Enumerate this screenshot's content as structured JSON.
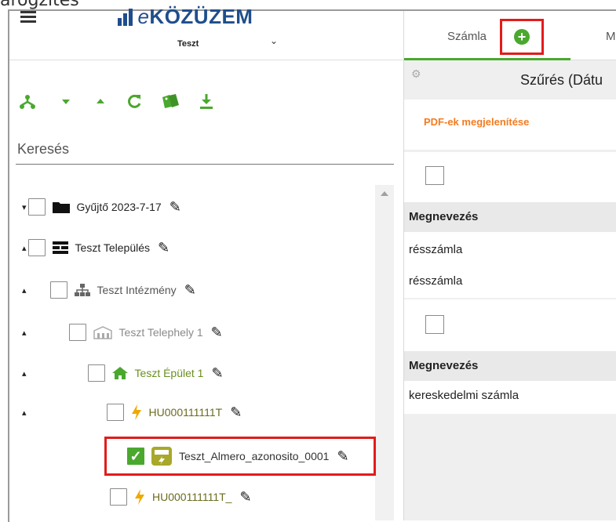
{
  "page_title_fragment": "árögzítés",
  "header": {
    "menu_icon": "hamburger-icon",
    "logo_prefix": "e",
    "logo_text": "KÖZÜZEM",
    "environment": "Teszt"
  },
  "toolbar": {
    "icons": [
      "hierarchy-icon",
      "caret-down-icon",
      "caret-up-icon",
      "refresh-icon",
      "tags-icon",
      "download-icon"
    ]
  },
  "search": {
    "label": "Keresés"
  },
  "tree": {
    "items": [
      {
        "label": "Gyűjtő 2023-7-17",
        "icon": "folder-icon",
        "caret": "down",
        "checked": false
      },
      {
        "label": "Teszt Település",
        "icon": "city-icon",
        "caret": "up",
        "checked": false
      },
      {
        "label": "Teszt Intézmény",
        "icon": "org-chart-icon",
        "caret": "up",
        "checked": false
      },
      {
        "label": "Teszt Telephely 1",
        "icon": "building-icon",
        "caret": "up",
        "checked": false
      },
      {
        "label": "Teszt Épület 1",
        "icon": "house-icon",
        "caret": "up",
        "checked": false
      },
      {
        "label": "HU000111111T",
        "icon": "lightning-icon",
        "caret": "up",
        "checked": false
      },
      {
        "label": "Teszt_Almero_azonosito_0001",
        "icon": "meter-icon",
        "caret": "",
        "checked": true
      },
      {
        "label": "HU000111111T_",
        "icon": "lightning-icon",
        "caret": "",
        "checked": false
      }
    ]
  },
  "tabs": {
    "first": "Számla",
    "second_fragment": "M",
    "add_icon": "plus-circle-icon"
  },
  "filter": {
    "label": "Szűrés (Dátu",
    "icon": "gear-icon"
  },
  "pdf": {
    "link": "PDF-ek megjelenítése"
  },
  "cards": [
    {
      "header": "Megnevezés",
      "rows": [
        "résszámla",
        "résszámla"
      ]
    },
    {
      "header": "Megnevezés",
      "rows": [
        "kereskedelmi számla"
      ]
    }
  ],
  "colors": {
    "accent": "#4aa82e",
    "brand": "#1f4e8c",
    "highlight": "#e31b1b",
    "link": "#f47b20"
  }
}
